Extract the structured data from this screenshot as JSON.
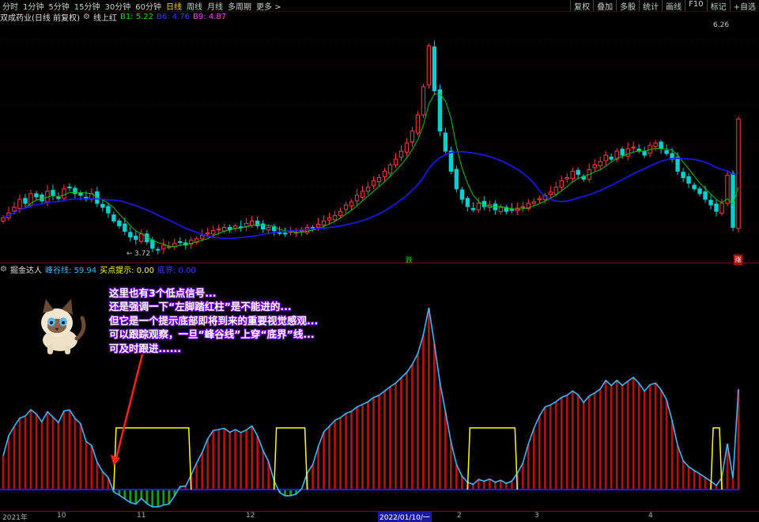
{
  "toolbar": {
    "periods": [
      "分时",
      "1分钟",
      "5分钟",
      "15分钟",
      "30分钟",
      "60分钟",
      "日线",
      "周线",
      "月线",
      "多周期",
      "更多 >"
    ],
    "active_index": 6,
    "right_buttons": [
      "复权",
      "叠加",
      "多股",
      "统计",
      "画线",
      "F10",
      "标记",
      "+自选"
    ]
  },
  "main_info": {
    "title": "双成药业(日线 前复权)",
    "indicator_name": "线上红",
    "b1_label": "B1: 5.22",
    "b6_label": "B6: 4.76",
    "b9_label": "B9: 4.87"
  },
  "main_labels": {
    "high_price": "6.26",
    "low_price": "3.72",
    "low_arrow": "←",
    "tag_die": "跌",
    "tag_zhang": "涨"
  },
  "sub_info": {
    "name": "掘金达人",
    "feng_gu": "峰谷线: 59.94",
    "mai_dian": "买点提示: 0.00",
    "di_jie": "底界: 0.00"
  },
  "annotation": {
    "lines": [
      "这里也有3个低点信号...",
      "还是强调一下“左脚踏红柱”是不能进的...",
      "但它是一个提示底部即将到来的重要视觉感观...",
      "可以跟踪观察，一旦“峰谷线”上穿“底界”线...",
      "可及时跟进......"
    ]
  },
  "bottom_axis": {
    "labels": [
      "2021年",
      "10",
      "11",
      "12",
      "2022/01/10/一",
      "2",
      "3",
      "4"
    ],
    "selected_index": 4
  },
  "colors": {
    "up": "#ff3c3c",
    "down": "#00d0d0",
    "ma_green": "#00c800",
    "ma_blue": "#1a1aff",
    "feng_gu_line": "#3ab8ff",
    "buy_signal": "#ffff00",
    "bar_red": "#b01010",
    "bar_green": "#10a010",
    "annotation_outline": "#7a00e0"
  },
  "chart_data": {
    "type": "candlestick",
    "price_range": [
      3.72,
      6.26
    ],
    "closes": [
      4.12,
      4.18,
      4.25,
      4.35,
      4.3,
      4.42,
      4.38,
      4.33,
      4.45,
      4.4,
      4.36,
      4.48,
      4.5,
      4.42,
      4.4,
      4.35,
      4.42,
      4.3,
      4.25,
      4.18,
      4.08,
      4.02,
      3.95,
      3.88,
      3.85,
      3.92,
      3.82,
      3.74,
      3.72,
      3.78,
      3.76,
      3.8,
      3.82,
      3.78,
      3.84,
      3.86,
      3.9,
      3.93,
      3.96,
      3.98,
      4.0,
      3.97,
      4.02,
      4.0,
      4.05,
      4.08,
      4.02,
      3.98,
      4.0,
      3.96,
      3.93,
      3.92,
      3.95,
      3.94,
      3.96,
      4.0,
      3.98,
      4.04,
      4.08,
      4.12,
      4.15,
      4.2,
      4.28,
      4.32,
      4.4,
      4.45,
      4.5,
      4.58,
      4.62,
      4.7,
      4.78,
      4.85,
      4.95,
      5.05,
      5.2,
      5.4,
      5.75,
      6.26,
      5.7,
      5.2,
      4.95,
      4.7,
      4.48,
      4.35,
      4.26,
      4.22,
      4.3,
      4.26,
      4.28,
      4.22,
      4.25,
      4.2,
      4.22,
      4.24,
      4.26,
      4.3,
      4.32,
      4.36,
      4.4,
      4.44,
      4.5,
      4.58,
      4.62,
      4.7,
      4.66,
      4.6,
      4.72,
      4.78,
      4.82,
      4.9,
      4.85,
      4.95,
      4.9,
      4.98,
      5.0,
      4.95,
      4.9,
      5.02,
      5.05,
      4.98,
      4.92,
      4.85,
      4.7,
      4.62,
      4.55,
      4.48,
      4.42,
      4.35,
      4.28,
      4.2,
      4.3,
      4.65,
      4.0,
      5.35
    ]
  }
}
